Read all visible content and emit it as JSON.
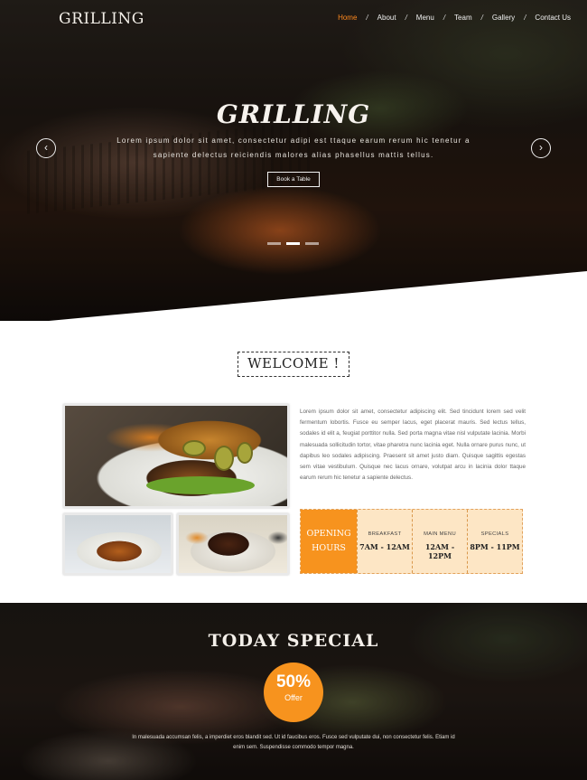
{
  "header": {
    "brand": "GRILLING",
    "nav": [
      {
        "label": "Home",
        "active": true
      },
      {
        "label": "About",
        "active": false
      },
      {
        "label": "Menu",
        "active": false
      },
      {
        "label": "Team",
        "active": false
      },
      {
        "label": "Gallery",
        "active": false
      },
      {
        "label": "Contact Us",
        "active": false
      }
    ],
    "nav_separator": "/"
  },
  "hero": {
    "title": "GRILLING",
    "subtitle": "Lorem ipsum dolor sit amet, consectetur adipi est ttaque earum rerum hic tenetur a sapiente delectus reiciendis malores alias phasellus mattis tellus.",
    "button_label": "Book a Table",
    "prev_icon": "‹",
    "next_icon": "›",
    "slides": 3,
    "active_slide": 2
  },
  "welcome": {
    "title": "WELCOME !",
    "text": "Lorem ipsum dolor sit amet, consectetur adipiscing elit. Sed tincidunt lorem sed velit fermentum lobortis. Fusce eu semper lacus, eget placerat mauris. Sed lectus tellus, sodales id elit a, feugiat porttitor nulla. Sed porta magna vitae nisl vulputate lacinia. Morbi malesuada sollicitudin tortor, vitae pharetra nunc lacinia eget. Nulla ornare purus nunc, ut dapibus leo sodales adipiscing. Praesent sit amet justo diam. Quisque sagittis egestas sem vitae vestibulum. Quisque nec lacus ornare, volutpat arcu in lacinia dolor ttaque earum rerum hic tenetur a sapiente delectus."
  },
  "hours": {
    "heading_line1": "OPENING",
    "heading_line2": "HOURS",
    "items": [
      {
        "label": "BREAKFAST",
        "value": "7AM - 12AM"
      },
      {
        "label": "MAIN MENU",
        "value": "12AM - 12PM"
      },
      {
        "label": "SPECIALS",
        "value": "8PM - 11PM"
      }
    ]
  },
  "special": {
    "title": "TODAY SPECIAL",
    "badge_percent": "50%",
    "badge_label": "Offer",
    "text": "In malesuada accumsan felis, a imperdiet eros blandit sed. Ut id faucibus eros. Fusce sed vulputate dui, non consectetur felis. Etiam id enim sem. Suspendisse commodo tempor magna."
  },
  "colors": {
    "accent": "#f7931e",
    "hours_bg": "#fde6c5",
    "nav_active": "#ff8a1e"
  }
}
